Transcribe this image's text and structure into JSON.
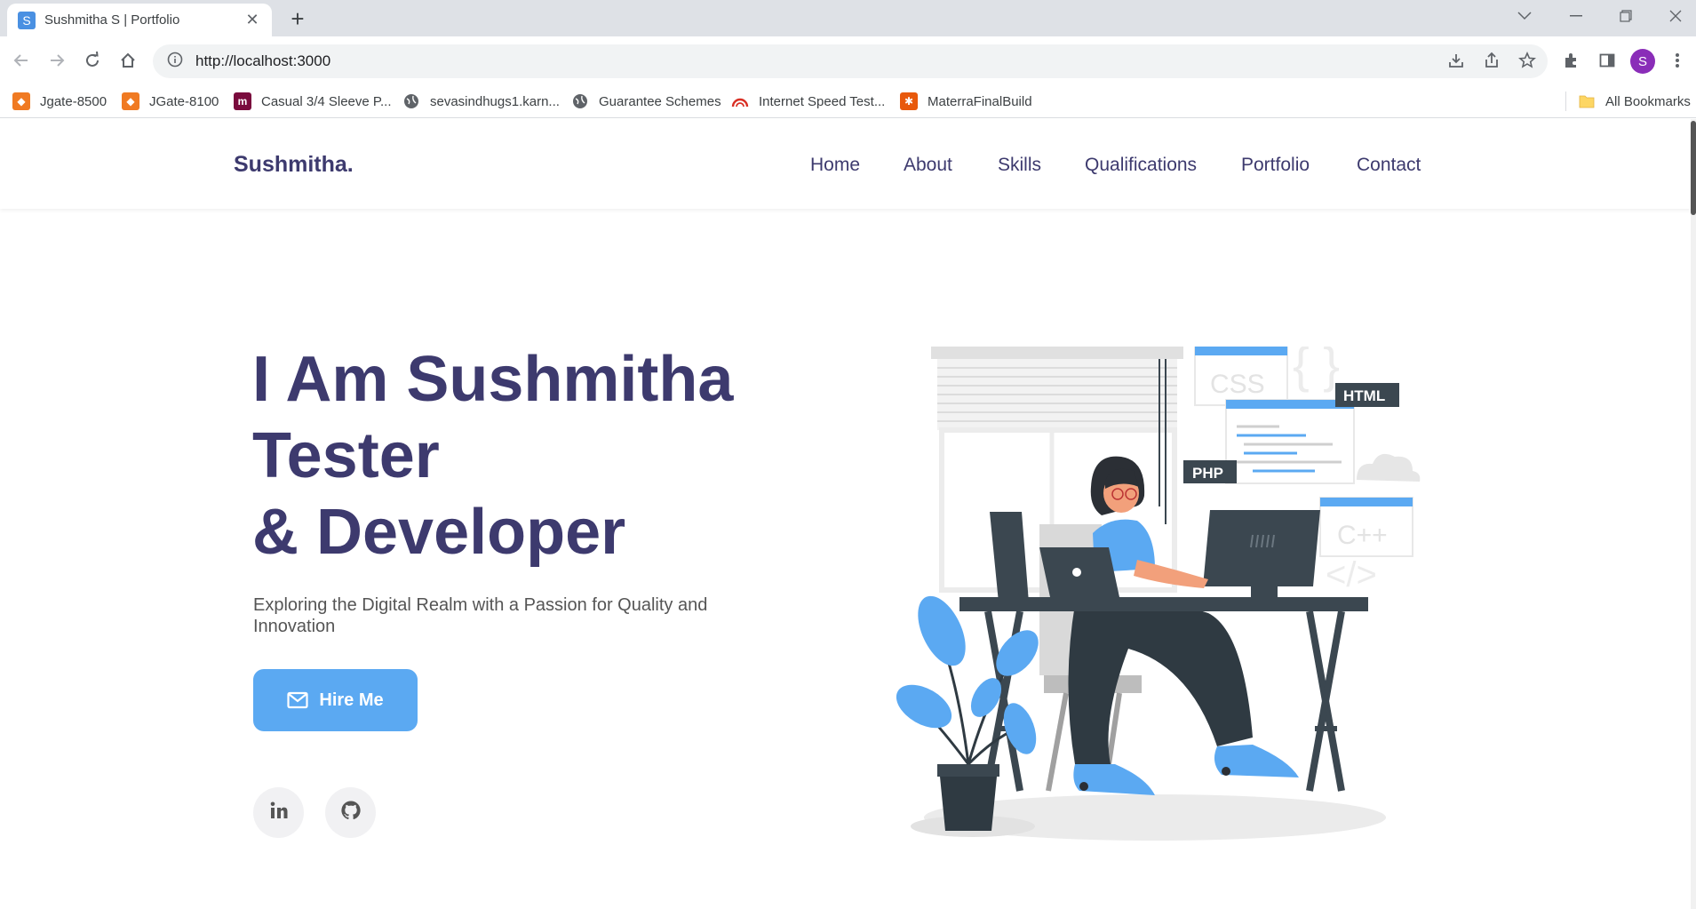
{
  "browser": {
    "tab_title": "Sushmitha S | Portfolio",
    "tab_favicon_letter": "S",
    "url": "http://localhost:3000",
    "profile_initial": "S"
  },
  "bookmarks": [
    {
      "label": "Jgate-8500",
      "icon": "jgate-icon",
      "color": "#f07a22"
    },
    {
      "label": "JGate-8100",
      "icon": "jgate-icon",
      "color": "#f07a22"
    },
    {
      "label": "Casual 3/4 Sleeve P...",
      "icon": "myntra-icon",
      "color": "#7a0b3d"
    },
    {
      "label": "sevasindhugs1.karn...",
      "icon": "globe-icon",
      "color": "#5f6368"
    },
    {
      "label": "Guarantee Schemes",
      "icon": "globe-icon",
      "color": "#5f6368"
    },
    {
      "label": "Internet Speed Test...",
      "icon": "speedometer-icon",
      "color": "#d93025"
    },
    {
      "label": "MaterraFinalBuild",
      "icon": "materra-icon",
      "color": "#e8590c"
    }
  ],
  "all_bookmarks": "All Bookmarks",
  "site": {
    "logo": "Sushmitha.",
    "nav": [
      "Home",
      "About",
      "Skills",
      "Qualifications",
      "Portfolio",
      "Contact"
    ]
  },
  "hero": {
    "title_line1": "I Am Sushmitha",
    "title_line2": "Tester",
    "title_line3": "& Developer",
    "subtitle": "Exploring the Digital Realm with a Passion for Quality and Innovation",
    "cta": "Hire Me",
    "socials": [
      "linkedin-icon",
      "github-icon"
    ]
  },
  "illustration": {
    "tags": {
      "css": "CSS",
      "html": "HTML",
      "php": "PHP",
      "cpp": "C++"
    }
  },
  "colors": {
    "brand": "#3d3a6e",
    "accent": "#5ba9f2",
    "desk": "#3b4750"
  }
}
